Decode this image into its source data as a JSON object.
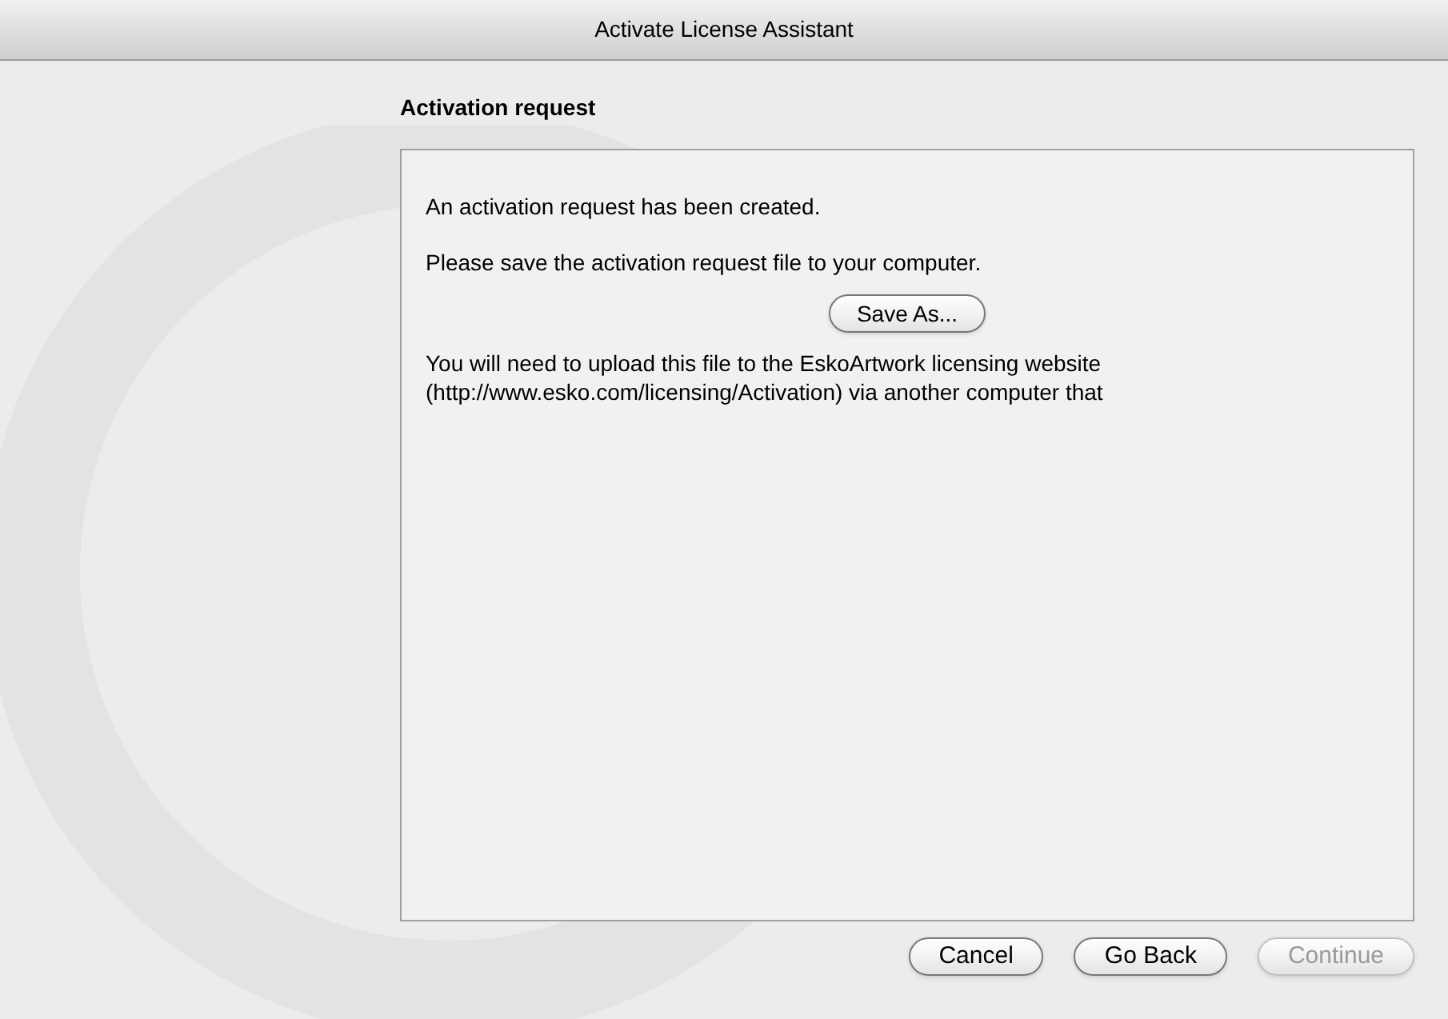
{
  "window": {
    "title": "Activate License Assistant"
  },
  "heading": "Activation request",
  "panel": {
    "line_1": "An activation request has been created.",
    "line_2": "Please save the activation request file to your computer.",
    "save_button": "Save As...",
    "line_3": "You will need to upload this file to the EskoArtwork licensing website (http://www.esko.com/licensing/Activation) via another computer that"
  },
  "buttons": [
    {
      "label": "Cancel",
      "disabled": false
    },
    {
      "label": "Go Back",
      "disabled": false
    },
    {
      "label": "Continue",
      "disabled": true
    }
  ]
}
